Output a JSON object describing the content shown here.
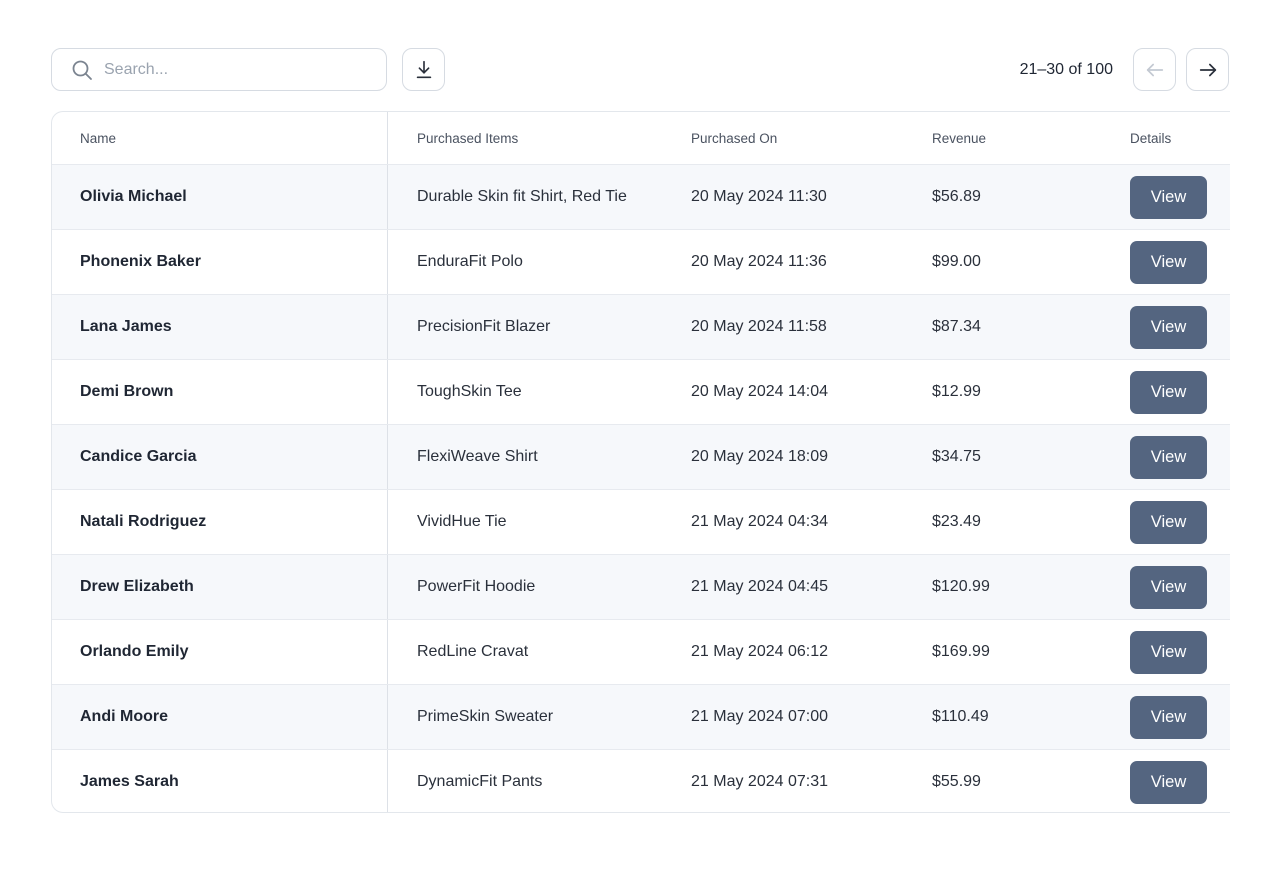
{
  "search": {
    "placeholder": "Search...",
    "value": ""
  },
  "pagination": {
    "info": "21–30 of 100"
  },
  "table": {
    "columns": [
      "Name",
      "Purchased Items",
      "Purchased On",
      "Revenue",
      "Details"
    ],
    "rows": [
      {
        "name": "Olivia Michael",
        "items": "Durable Skin fit Shirt, Red Tie",
        "date": "20 May 2024 11:30",
        "revenue": "$56.89",
        "action": "View"
      },
      {
        "name": "Phonenix Baker",
        "items": "EnduraFit Polo",
        "date": "20 May 2024 11:36",
        "revenue": "$99.00",
        "action": "View"
      },
      {
        "name": "Lana James",
        "items": "PrecisionFit Blazer",
        "date": "20 May 2024 11:58",
        "revenue": "$87.34",
        "action": "View"
      },
      {
        "name": "Demi Brown",
        "items": "ToughSkin Tee",
        "date": "20 May 2024 14:04",
        "revenue": "$12.99",
        "action": "View"
      },
      {
        "name": "Candice Garcia",
        "items": "FlexiWeave Shirt",
        "date": "20 May 2024 18:09",
        "revenue": "$34.75",
        "action": "View"
      },
      {
        "name": "Natali Rodriguez",
        "items": "VividHue Tie",
        "date": "21 May 2024 04:34",
        "revenue": "$23.49",
        "action": "View"
      },
      {
        "name": "Drew Elizabeth",
        "items": "PowerFit Hoodie",
        "date": "21 May 2024 04:45",
        "revenue": "$120.99",
        "action": "View"
      },
      {
        "name": "Orlando Emily",
        "items": "RedLine Cravat",
        "date": "21 May 2024 06:12",
        "revenue": "$169.99",
        "action": "View"
      },
      {
        "name": "Andi Moore",
        "items": "PrimeSkin Sweater",
        "date": "21 May 2024 07:00",
        "revenue": "$110.49",
        "action": "View"
      },
      {
        "name": "James Sarah",
        "items": "DynamicFit Pants",
        "date": "21 May 2024 07:31",
        "revenue": "$55.99",
        "action": "View"
      }
    ]
  },
  "icons": {
    "search": "search-icon",
    "download": "download-icon",
    "prev": "arrow-left-icon",
    "next": "arrow-right-icon"
  },
  "colors": {
    "button_bg": "#546580",
    "row_alt_bg": "#f6f8fb",
    "border": "#d6dbe2",
    "prev_disabled": "#c3c9d2"
  }
}
